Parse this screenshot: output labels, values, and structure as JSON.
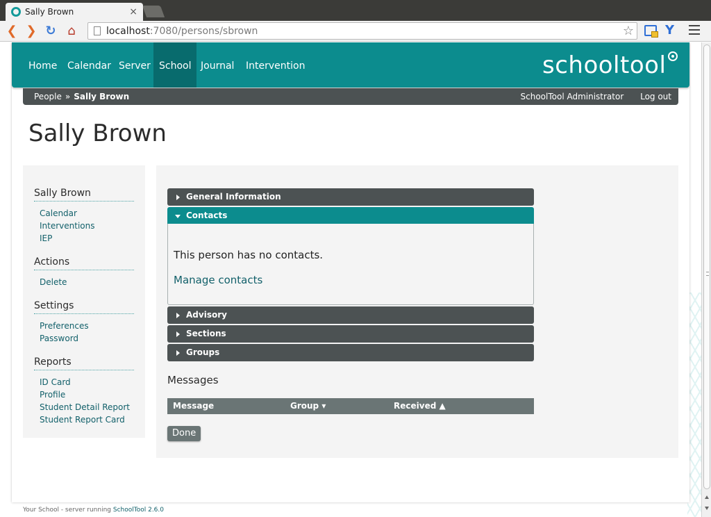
{
  "browser": {
    "tab_title": "Sally Brown",
    "tab_close": "×",
    "url_host": "localhost",
    "url_rest": ":7080/persons/sbrown"
  },
  "nav": {
    "items": [
      {
        "label": "Home"
      },
      {
        "label": "Calendar"
      },
      {
        "label": "Server"
      },
      {
        "label": "School",
        "active": true
      },
      {
        "label": "Journal"
      },
      {
        "label": "Intervention"
      }
    ],
    "brand": "schooltool"
  },
  "breadcrumb": {
    "parent": "People",
    "separator": "»",
    "current": "Sally Brown"
  },
  "user": {
    "name": "SchoolTool Administrator",
    "logout": "Log out"
  },
  "page_title": "Sally Brown",
  "sidebar": {
    "sections": [
      {
        "heading": "Sally Brown",
        "links": [
          "Calendar",
          "Interventions",
          "IEP"
        ]
      },
      {
        "heading": "Actions",
        "links": [
          "Delete"
        ]
      },
      {
        "heading": "Settings",
        "links": [
          "Preferences",
          "Password"
        ]
      },
      {
        "heading": "Reports",
        "links": [
          "ID Card",
          "Profile",
          "Student Detail Report",
          "Student Report Card"
        ]
      }
    ]
  },
  "accordion": {
    "general": "General Information",
    "contacts": "Contacts",
    "contacts_empty": "This person has no contacts.",
    "manage_contacts": "Manage contacts",
    "advisory": "Advisory",
    "sections": "Sections",
    "groups": "Groups"
  },
  "messages": {
    "title": "Messages",
    "col_message": "Message",
    "col_group": "Group ▾",
    "col_received": "Received ▲"
  },
  "done_label": "Done",
  "footer": {
    "prefix": "Your School - server running ",
    "link": "SchoolTool 2.6.0"
  },
  "colors": {
    "teal": "#0c8c8e",
    "teal_dark": "#086b6d",
    "slate": "#4c5253",
    "link": "#12606a"
  }
}
